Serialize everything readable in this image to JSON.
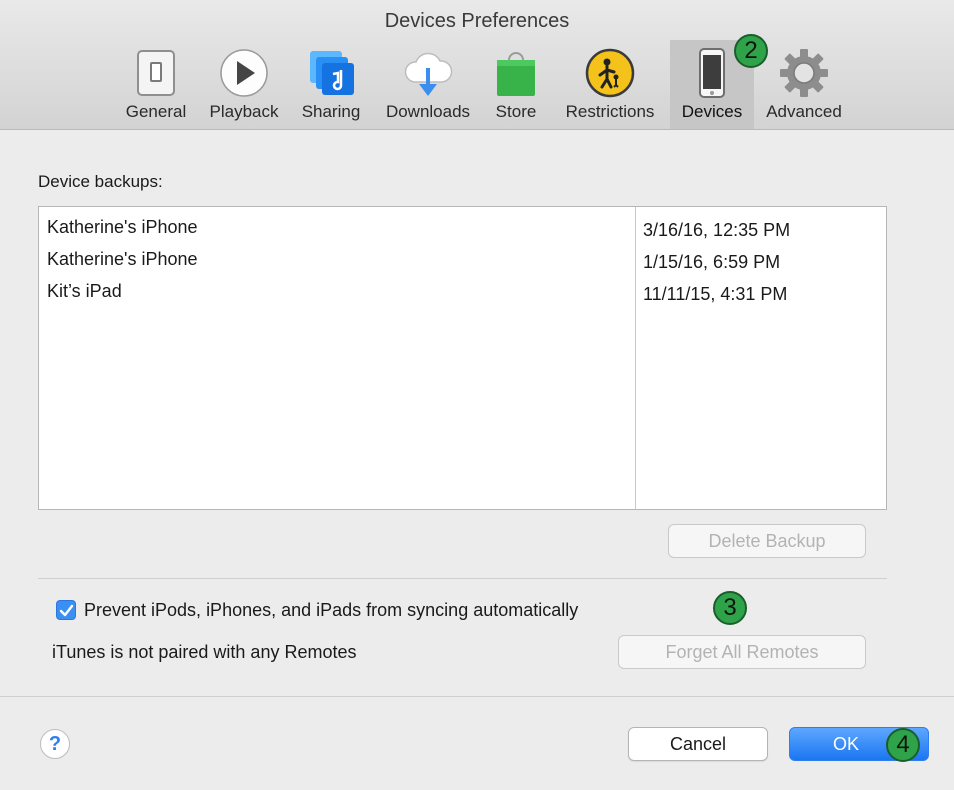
{
  "window": {
    "title": "Devices Preferences"
  },
  "toolbar": {
    "tabs": [
      {
        "label": "General",
        "icon": "general-switch-icon"
      },
      {
        "label": "Playback",
        "icon": "play-icon"
      },
      {
        "label": "Sharing",
        "icon": "sharing-music-icon"
      },
      {
        "label": "Downloads",
        "icon": "cloud-download-icon"
      },
      {
        "label": "Store",
        "icon": "shopping-bag-icon"
      },
      {
        "label": "Restrictions",
        "icon": "restrictions-icon"
      },
      {
        "label": "Devices",
        "icon": "phone-device-icon",
        "selected": true
      },
      {
        "label": "Advanced",
        "icon": "gear-icon"
      }
    ]
  },
  "backups": {
    "heading": "Device backups:",
    "rows": [
      {
        "name": "Katherine's iPhone",
        "date": "3/16/16, 12:35 PM"
      },
      {
        "name": "Katherine's iPhone",
        "date": "1/15/16, 6:59 PM"
      },
      {
        "name": "Kit’s iPad",
        "date": "11/11/15, 4:31 PM"
      }
    ],
    "delete_label": "Delete Backup"
  },
  "options": {
    "prevent_sync_label": "Prevent iPods, iPhones, and iPads from syncing automatically",
    "prevent_sync_checked": true,
    "remotes_status": "iTunes is not paired with any Remotes",
    "forget_remotes_label": "Forget All Remotes"
  },
  "footer": {
    "help_label": "?",
    "cancel_label": "Cancel",
    "ok_label": "OK"
  },
  "annotations": {
    "badge_2": "2",
    "badge_3": "3",
    "badge_4": "4"
  },
  "colors": {
    "accent": "#1a76f1",
    "badge_green": "#2ea34a"
  }
}
